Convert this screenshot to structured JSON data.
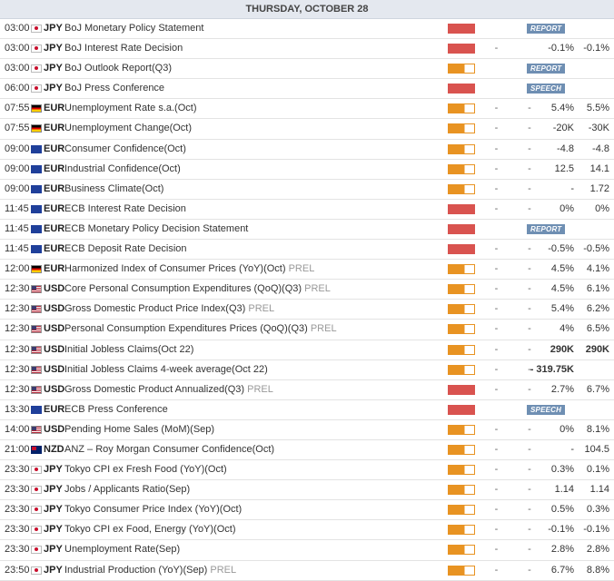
{
  "header": {
    "title": "THURSDAY, OCTOBER 28"
  },
  "colors": {
    "high": "#d9534f",
    "medium": "#e89322",
    "badge": "#6f8fb3"
  },
  "events": [
    {
      "time": "03:00",
      "flag": "jp",
      "currency": "JPY",
      "name": "BoJ Monetary Policy Statement",
      "tag": "",
      "impact": "high",
      "badge": "REPORT"
    },
    {
      "time": "03:00",
      "flag": "jp",
      "currency": "JPY",
      "name": "BoJ Interest Rate Decision",
      "tag": "",
      "impact": "high",
      "actual": "-",
      "consensus": "-0.1%",
      "previous": "-0.1%"
    },
    {
      "time": "03:00",
      "flag": "jp",
      "currency": "JPY",
      "name": "BoJ Outlook Report(Q3)",
      "tag": "",
      "impact": "medium",
      "badge": "REPORT"
    },
    {
      "time": "06:00",
      "flag": "jp",
      "currency": "JPY",
      "name": "BoJ Press Conference",
      "tag": "",
      "impact": "high",
      "badge": "SPEECH"
    },
    {
      "time": "07:55",
      "flag": "de",
      "currency": "EUR",
      "name": "Unemployment Rate s.a.(Oct)",
      "tag": "",
      "impact": "medium",
      "actual": "-",
      "mid": "-",
      "consensus": "5.4%",
      "previous": "5.5%"
    },
    {
      "time": "07:55",
      "flag": "de",
      "currency": "EUR",
      "name": "Unemployment Change(Oct)",
      "tag": "",
      "impact": "medium",
      "actual": "-",
      "mid": "-",
      "consensus": "-20K",
      "previous": "-30K"
    },
    {
      "time": "09:00",
      "flag": "eu",
      "currency": "EUR",
      "name": "Consumer Confidence(Oct)",
      "tag": "",
      "impact": "medium",
      "actual": "-",
      "mid": "-",
      "consensus": "-4.8",
      "previous": "-4.8"
    },
    {
      "time": "09:00",
      "flag": "eu",
      "currency": "EUR",
      "name": "Industrial Confidence(Oct)",
      "tag": "",
      "impact": "medium",
      "actual": "-",
      "mid": "-",
      "consensus": "12.5",
      "previous": "14.1"
    },
    {
      "time": "09:00",
      "flag": "eu",
      "currency": "EUR",
      "name": "Business Climate(Oct)",
      "tag": "",
      "impact": "medium",
      "actual": "-",
      "mid": "-",
      "consensus": "-",
      "previous": "1.72"
    },
    {
      "time": "11:45",
      "flag": "eu",
      "currency": "EUR",
      "name": "ECB Interest Rate Decision",
      "tag": "",
      "impact": "high",
      "actual": "-",
      "mid": "-",
      "consensus": "0%",
      "previous": "0%"
    },
    {
      "time": "11:45",
      "flag": "eu",
      "currency": "EUR",
      "name": "ECB Monetary Policy Decision Statement",
      "tag": "",
      "impact": "high",
      "badge": "REPORT"
    },
    {
      "time": "11:45",
      "flag": "eu",
      "currency": "EUR",
      "name": "ECB Deposit Rate Decision",
      "tag": "",
      "impact": "high",
      "actual": "-",
      "mid": "-",
      "consensus": "-0.5%",
      "previous": "-0.5%"
    },
    {
      "time": "12:00",
      "flag": "de",
      "currency": "EUR",
      "name": "Harmonized Index of Consumer Prices (YoY)(Oct)",
      "tag": "PREL",
      "impact": "medium",
      "actual": "-",
      "mid": "-",
      "consensus": "4.5%",
      "previous": "4.1%"
    },
    {
      "time": "12:30",
      "flag": "us",
      "currency": "USD",
      "name": "Core Personal Consumption Expenditures (QoQ)(Q3)",
      "tag": "PREL",
      "impact": "medium",
      "actual": "-",
      "mid": "-",
      "consensus": "4.5%",
      "previous": "6.1%"
    },
    {
      "time": "12:30",
      "flag": "us",
      "currency": "USD",
      "name": "Gross Domestic Product Price Index(Q3)",
      "tag": "PREL",
      "impact": "medium",
      "actual": "-",
      "mid": "-",
      "consensus": "5.4%",
      "previous": "6.2%"
    },
    {
      "time": "12:30",
      "flag": "us",
      "currency": "USD",
      "name": "Personal Consumption Expenditures Prices (QoQ)(Q3)",
      "tag": "PREL",
      "impact": "medium",
      "actual": "-",
      "mid": "-",
      "consensus": "4%",
      "previous": "6.5%"
    },
    {
      "time": "12:30",
      "flag": "us",
      "currency": "USD",
      "name": "Initial Jobless Claims(Oct 22)",
      "tag": "",
      "impact": "medium",
      "actual": "-",
      "mid": "-",
      "consensus": "290K",
      "previous": "290K",
      "bold": true
    },
    {
      "time": "12:30",
      "flag": "us",
      "currency": "USD",
      "name": "Initial Jobless Claims 4-week average(Oct 22)",
      "tag": "",
      "impact": "medium",
      "actual": "-",
      "mid": "-",
      "consensus": "- 319.75K",
      "previous": "",
      "bold": true
    },
    {
      "time": "12:30",
      "flag": "us",
      "currency": "USD",
      "name": "Gross Domestic Product Annualized(Q3)",
      "tag": "PREL",
      "impact": "high",
      "actual": "-",
      "mid": "-",
      "consensus": "2.7%",
      "previous": "6.7%"
    },
    {
      "time": "13:30",
      "flag": "eu",
      "currency": "EUR",
      "name": "ECB Press Conference",
      "tag": "",
      "impact": "high",
      "badge": "SPEECH"
    },
    {
      "time": "14:00",
      "flag": "us",
      "currency": "USD",
      "name": "Pending Home Sales (MoM)(Sep)",
      "tag": "",
      "impact": "medium",
      "actual": "-",
      "mid": "-",
      "consensus": "0%",
      "previous": "8.1%"
    },
    {
      "time": "21:00",
      "flag": "nz",
      "currency": "NZD",
      "name": "ANZ – Roy Morgan Consumer Confidence(Oct)",
      "tag": "",
      "impact": "medium",
      "actual": "-",
      "mid": "-",
      "consensus": "-",
      "previous": "104.5"
    },
    {
      "time": "23:30",
      "flag": "jp",
      "currency": "JPY",
      "name": "Tokyo CPI ex Fresh Food (YoY)(Oct)",
      "tag": "",
      "impact": "medium",
      "actual": "-",
      "mid": "-",
      "consensus": "0.3%",
      "previous": "0.1%"
    },
    {
      "time": "23:30",
      "flag": "jp",
      "currency": "JPY",
      "name": "Jobs / Applicants Ratio(Sep)",
      "tag": "",
      "impact": "medium",
      "actual": "-",
      "mid": "-",
      "consensus": "1.14",
      "previous": "1.14"
    },
    {
      "time": "23:30",
      "flag": "jp",
      "currency": "JPY",
      "name": "Tokyo Consumer Price Index (YoY)(Oct)",
      "tag": "",
      "impact": "medium",
      "actual": "-",
      "mid": "-",
      "consensus": "0.5%",
      "previous": "0.3%"
    },
    {
      "time": "23:30",
      "flag": "jp",
      "currency": "JPY",
      "name": "Tokyo CPI ex Food, Energy (YoY)(Oct)",
      "tag": "",
      "impact": "medium",
      "actual": "-",
      "mid": "-",
      "consensus": "-0.1%",
      "previous": "-0.1%"
    },
    {
      "time": "23:30",
      "flag": "jp",
      "currency": "JPY",
      "name": "Unemployment Rate(Sep)",
      "tag": "",
      "impact": "medium",
      "actual": "-",
      "mid": "-",
      "consensus": "2.8%",
      "previous": "2.8%"
    },
    {
      "time": "23:50",
      "flag": "jp",
      "currency": "JPY",
      "name": "Industrial Production (YoY)(Sep)",
      "tag": "PREL",
      "impact": "medium",
      "actual": "-",
      "mid": "-",
      "consensus": "6.7%",
      "previous": "8.8%"
    }
  ]
}
